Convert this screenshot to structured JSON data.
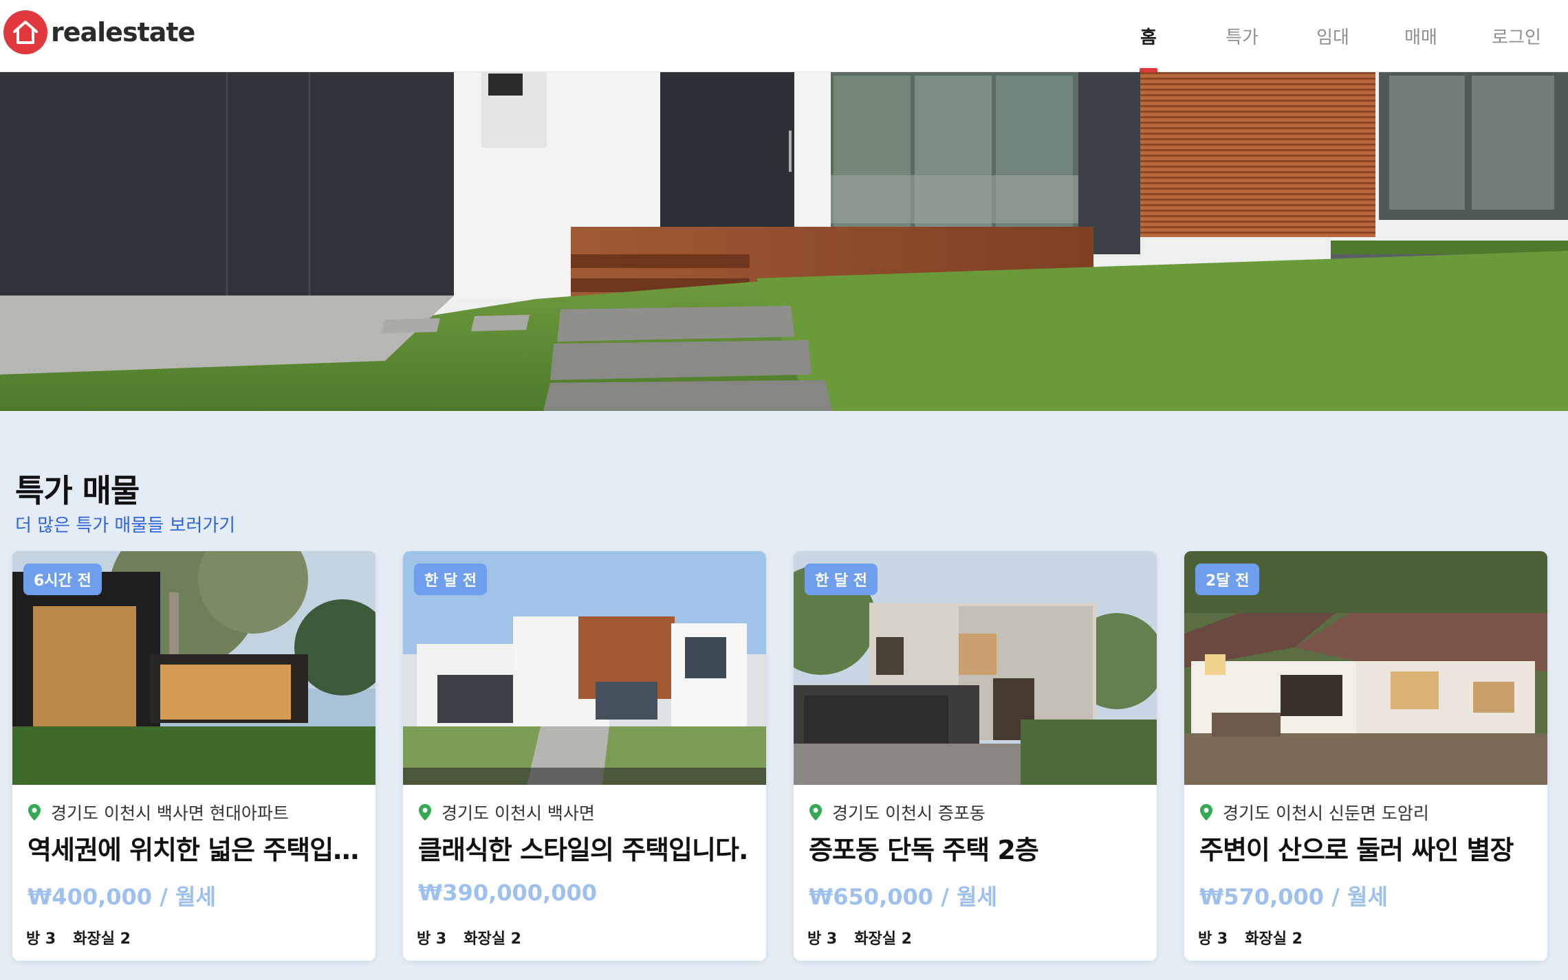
{
  "brand": {
    "name": "realestate"
  },
  "nav": {
    "items": [
      {
        "label": "홈",
        "active": true
      },
      {
        "label": "특가",
        "active": false
      },
      {
        "label": "임대",
        "active": false
      },
      {
        "label": "매매",
        "active": false
      },
      {
        "label": "로그인",
        "active": false
      }
    ]
  },
  "section": {
    "title": "특가 매물",
    "link": "더 많은 특가 매물들 보러가기"
  },
  "listings": [
    {
      "badge": "6시간 전",
      "location": "경기도 이천시 백사면 현대아파트",
      "title": "역세권에 위치한 넓은 주택입니다",
      "price": "₩400,000 / 월세",
      "rooms": "방 3",
      "baths": "화장실 2"
    },
    {
      "badge": "한 달 전",
      "location": "경기도 이천시 백사면",
      "title": "클래식한 스타일의 주택입니다.",
      "price": "₩390,000,000",
      "rooms": "방 3",
      "baths": "화장실 2"
    },
    {
      "badge": "한 달 전",
      "location": "경기도 이천시 증포동",
      "title": "증포동 단독 주택 2층",
      "price": "₩650,000 / 월세",
      "rooms": "방 3",
      "baths": "화장실 2"
    },
    {
      "badge": "2달 전",
      "location": "경기도 이천시 신둔면 도암리",
      "title": "주변이 산으로 둘러 싸인 별장",
      "price": "₩570,000 / 월세",
      "rooms": "방 3",
      "baths": "화장실 2"
    }
  ],
  "colors": {
    "accent": "#e0383c",
    "link": "#2f64dc",
    "badge": "#6f9fec",
    "price": "#9dc0ef",
    "page_bg": "#e4ecf5"
  }
}
